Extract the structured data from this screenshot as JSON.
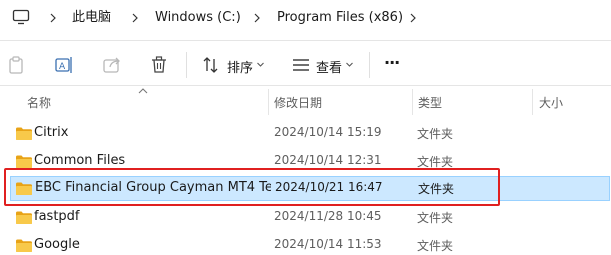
{
  "breadcrumb": {
    "items": [
      "此电脑",
      "Windows (C:)",
      "Program Files (x86)"
    ]
  },
  "toolbar": {
    "sort_label": "排序",
    "view_label": "查看",
    "more_label": "···"
  },
  "columns": {
    "name": "名称",
    "date": "修改日期",
    "type": "类型",
    "size": "大小"
  },
  "rows": [
    {
      "name": "Citrix",
      "date": "2024/10/14 15:19",
      "type": "文件夹"
    },
    {
      "name": "Common Files",
      "date": "2024/10/14 12:31",
      "type": "文件夹"
    },
    {
      "name": "EBC Financial Group Cayman MT4 Te...",
      "date": "2024/10/21 16:47",
      "type": "文件夹"
    },
    {
      "name": "fastpdf",
      "date": "2024/11/28 10:45",
      "type": "文件夹"
    },
    {
      "name": "Google",
      "date": "2024/10/14 11:53",
      "type": "文件夹"
    }
  ],
  "selected_row": 2,
  "colors": {
    "selection_bg": "#cce8ff",
    "selection_border": "#99d1ff",
    "annotation_red": "#e02020",
    "folder_yellow": "#f8c94a"
  }
}
